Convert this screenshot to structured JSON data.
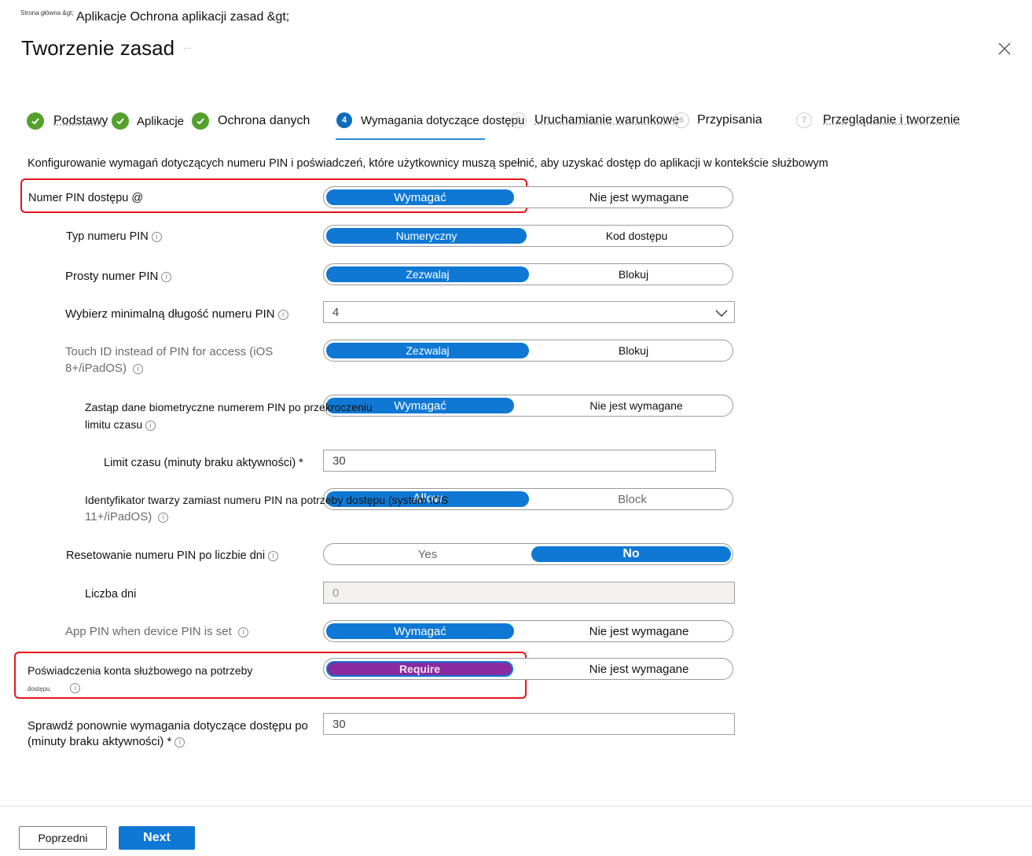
{
  "breadcrumb": {
    "home": "Strona główna &gt;",
    "path": "Aplikacje Ochrona aplikacji zasad &gt;"
  },
  "page": {
    "title": "Tworzenie zasad",
    "title_suffix": "...",
    "close_icon": "close-icon"
  },
  "steps": [
    {
      "num": "1",
      "label": "Podstawy",
      "state": "done"
    },
    {
      "num": "2",
      "label": "Aplikacje",
      "state": "done"
    },
    {
      "num": "3",
      "label": "Ochrona danych",
      "state": "done"
    },
    {
      "num": "4",
      "label": "Wymagania dotyczące dostępu",
      "state": "current"
    },
    {
      "num": "5",
      "label": "Uruchamianie warunkowe",
      "state": "todo"
    },
    {
      "num": "6",
      "label": "Przypisania",
      "state": "todo"
    },
    {
      "num": "7",
      "label": "Przeglądanie i tworzenie",
      "state": "todo"
    }
  ],
  "description": "Konfigurowanie wymagań dotyczących numeru PIN i poświadczeń, które użytkownicy muszą spełnić, aby uzyskać dostęp do aplikacji w kontekście służbowym",
  "settings": {
    "pin_access": {
      "label": "Numer PIN dostępu @",
      "options": [
        "Wymagać",
        "Nie jest wymagane"
      ],
      "selected": "Wymagać"
    },
    "pin_type": {
      "label": "Typ numeru PIN",
      "options": [
        "Numeryczny",
        "Kod dostępu"
      ],
      "selected": "Numeryczny"
    },
    "simple_pin": {
      "label": "Prosty numer PIN",
      "options": [
        "Zezwalaj",
        "Blokuj"
      ],
      "selected": "Zezwalaj"
    },
    "min_length": {
      "label": "Wybierz minimalną długość numeru PIN",
      "value": "4"
    },
    "touch_id": {
      "label_line1": "Touch ID instead of PIN for access (iOS",
      "label_line2": "8+/iPadOS)",
      "options": [
        "Zezwalaj",
        "Blokuj"
      ],
      "selected": "Zezwalaj"
    },
    "override_biometrics": {
      "label_line1": "Zastąp dane biometryczne numerem PIN po przekroczeniu",
      "label_line2": "limitu czasu",
      "options": [
        "Wymagać",
        "Nie jest wymagane"
      ],
      "selected": "Wymagać"
    },
    "timeout": {
      "label": "Limit czasu (minuty braku aktywności) *",
      "value": "30"
    },
    "face_id": {
      "label_line1": "Identyfikator twarzy zamiast numeru PIN na potrzeby dostępu (system iOS",
      "label_line2": "11+/iPadOS)",
      "options": [
        "Allow",
        "Block"
      ],
      "selected": "Allow"
    },
    "pin_reset": {
      "label": "Resetowanie numeru PIN po liczbie dni",
      "options": [
        "Yes",
        "No"
      ],
      "selected": "No"
    },
    "days": {
      "label": "Liczba dni",
      "value": "0"
    },
    "app_pin_device_pin": {
      "label": "App PIN when device PIN is set",
      "options": [
        "Wymagać",
        "Nie jest wymagane"
      ],
      "selected": "Wymagać"
    },
    "work_credentials": {
      "label_line1": "Poświadczenia konta służbowego na potrzeby",
      "label_line2": "dostępu",
      "options": [
        "Require",
        "Nie jest wymagane"
      ],
      "selected": "Require"
    },
    "recheck": {
      "label_line1": "Sprawdź ponownie wymagania dotyczące dostępu po",
      "label_line2": "(minuty braku aktywności) *",
      "value": "30"
    }
  },
  "footer": {
    "previous_label": "Poprzedni",
    "next_label": "Next"
  }
}
